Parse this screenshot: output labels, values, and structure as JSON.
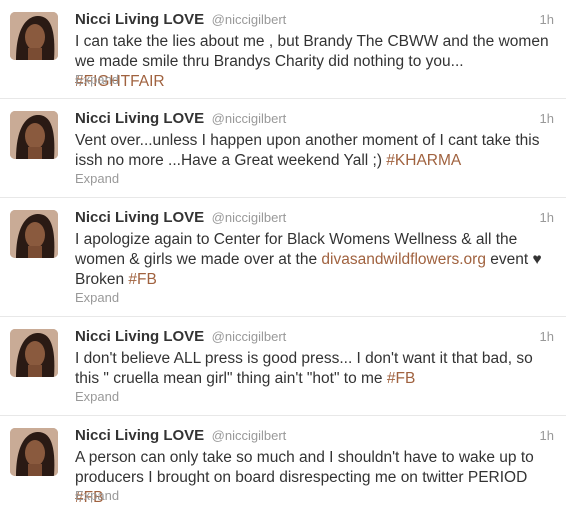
{
  "tweets": [
    {
      "name": "Nicci Living LOVE",
      "handle": "@niccigilbert",
      "time": "1h",
      "text_before": "I can take the lies about me , but Brandy The CBWW and the women we made smile thru Brandys Charity did nothing to you... ",
      "link": "",
      "text_after": "",
      "hashtag": "#FIGHTFAIR",
      "expand": "Expand"
    },
    {
      "name": "Nicci Living LOVE",
      "handle": "@niccigilbert",
      "time": "1h",
      "text_before": "Vent over...unless I happen upon another moment of I cant take this issh no more ...Have a Great weekend Yall ;) ",
      "link": "",
      "text_after": "",
      "hashtag": "#KHARMA",
      "expand": "Expand"
    },
    {
      "name": "Nicci Living LOVE",
      "handle": "@niccigilbert",
      "time": "1h",
      "text_before": "I apologize again to Center for Black Womens Wellness & all the women & girls we made over at the ",
      "link": "divasandwildflowers.org",
      "text_after": " event ♥ Broken ",
      "hashtag": "#FB",
      "expand": "Expand"
    },
    {
      "name": "Nicci Living LOVE",
      "handle": "@niccigilbert",
      "time": "1h",
      "text_before": "I don't believe ALL press is good press... I don't want it that bad, so this \" cruella mean girl\"  thing ain't \"hot\" to me ",
      "link": "",
      "text_after": "",
      "hashtag": "#FB",
      "expand": "Expand"
    },
    {
      "name": "Nicci Living LOVE",
      "handle": "@niccigilbert",
      "time": "1h",
      "text_before": "A person can only take so much and I shouldn't have to wake up to producers I brought on board disrespecting me on twitter PERIOD ",
      "link": "",
      "text_after": "",
      "hashtag": "#FB",
      "expand": "Expand"
    }
  ],
  "colors": {
    "link": "#a0623f",
    "name": "#333333",
    "meta": "#999999"
  }
}
